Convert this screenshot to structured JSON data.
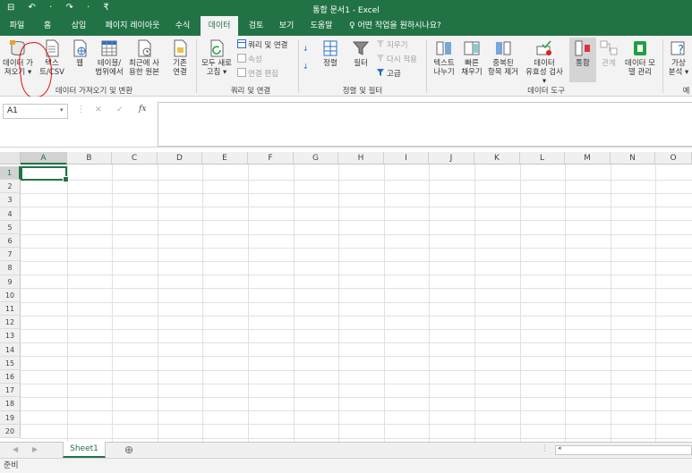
{
  "window": {
    "title": "통합 문서1  -  Excel",
    "quick_access": "⊟ ↶ · ↷ · ₹"
  },
  "tabs": [
    "파일",
    "홈",
    "삽입",
    "페이지 레이아웃",
    "수식",
    "데이터",
    "검토",
    "보기",
    "도움말"
  ],
  "active_tab": "데이터",
  "tell_me": "어떤 작업을 원하시나요?",
  "ribbon": {
    "get_data": {
      "btn1": [
        "데이터 가",
        "져오기 ▾"
      ],
      "btn2": [
        "텍스",
        "트/CSV"
      ],
      "btn3": [
        "웹"
      ],
      "btn4": [
        "테이블/",
        "범위에서"
      ],
      "btn5": [
        "최근에 사",
        "용한 원본"
      ],
      "btn6": [
        "기존",
        "연결"
      ],
      "label": "데이터 가져오기 및 변환"
    },
    "queries": {
      "refresh": [
        "모두 새로",
        "고침 ▾"
      ],
      "queries_connections": "쿼리 및 연결",
      "properties": "속성",
      "edit_links": "연결 편집",
      "label": "쿼리 및 연결"
    },
    "sort": {
      "sort": "정렬",
      "filter": "필터",
      "clear": "지우기",
      "reapply": "다시 적용",
      "advanced": "고급",
      "label": "정렬 및 필터"
    },
    "tools": {
      "text_to_columns": [
        "텍스트",
        "나누기"
      ],
      "flash_fill": [
        "빠른",
        "채우기"
      ],
      "remove_dup": [
        "중복된",
        "항목 제거"
      ],
      "validation": [
        "데이터",
        "유효성 검사 ▾"
      ],
      "consolidate": [
        "통합"
      ],
      "relations": [
        "관계"
      ],
      "data_model": [
        "데이터 모",
        "델 관리"
      ],
      "label": "데이터 도구"
    },
    "forecast": {
      "whatif": [
        "가상",
        "분석 ▾"
      ],
      "label": "예"
    }
  },
  "formula_bar": {
    "name_box": "A1",
    "cancel": "✕",
    "enter": "✓",
    "fx": "fx",
    "formula": ""
  },
  "columns": [
    "A",
    "B",
    "C",
    "D",
    "E",
    "F",
    "G",
    "H",
    "I",
    "J",
    "K",
    "L",
    "M",
    "N",
    "O"
  ],
  "rows": [
    "1",
    "2",
    "3",
    "4",
    "5",
    "6",
    "7",
    "8",
    "9",
    "10",
    "11",
    "12",
    "13",
    "14",
    "15",
    "16",
    "17",
    "18",
    "19",
    "20"
  ],
  "selected_cell": "A1",
  "sheets": [
    "Sheet1"
  ],
  "status": "준비",
  "colors": {
    "accent": "#217346",
    "annotation": "#e01010"
  }
}
